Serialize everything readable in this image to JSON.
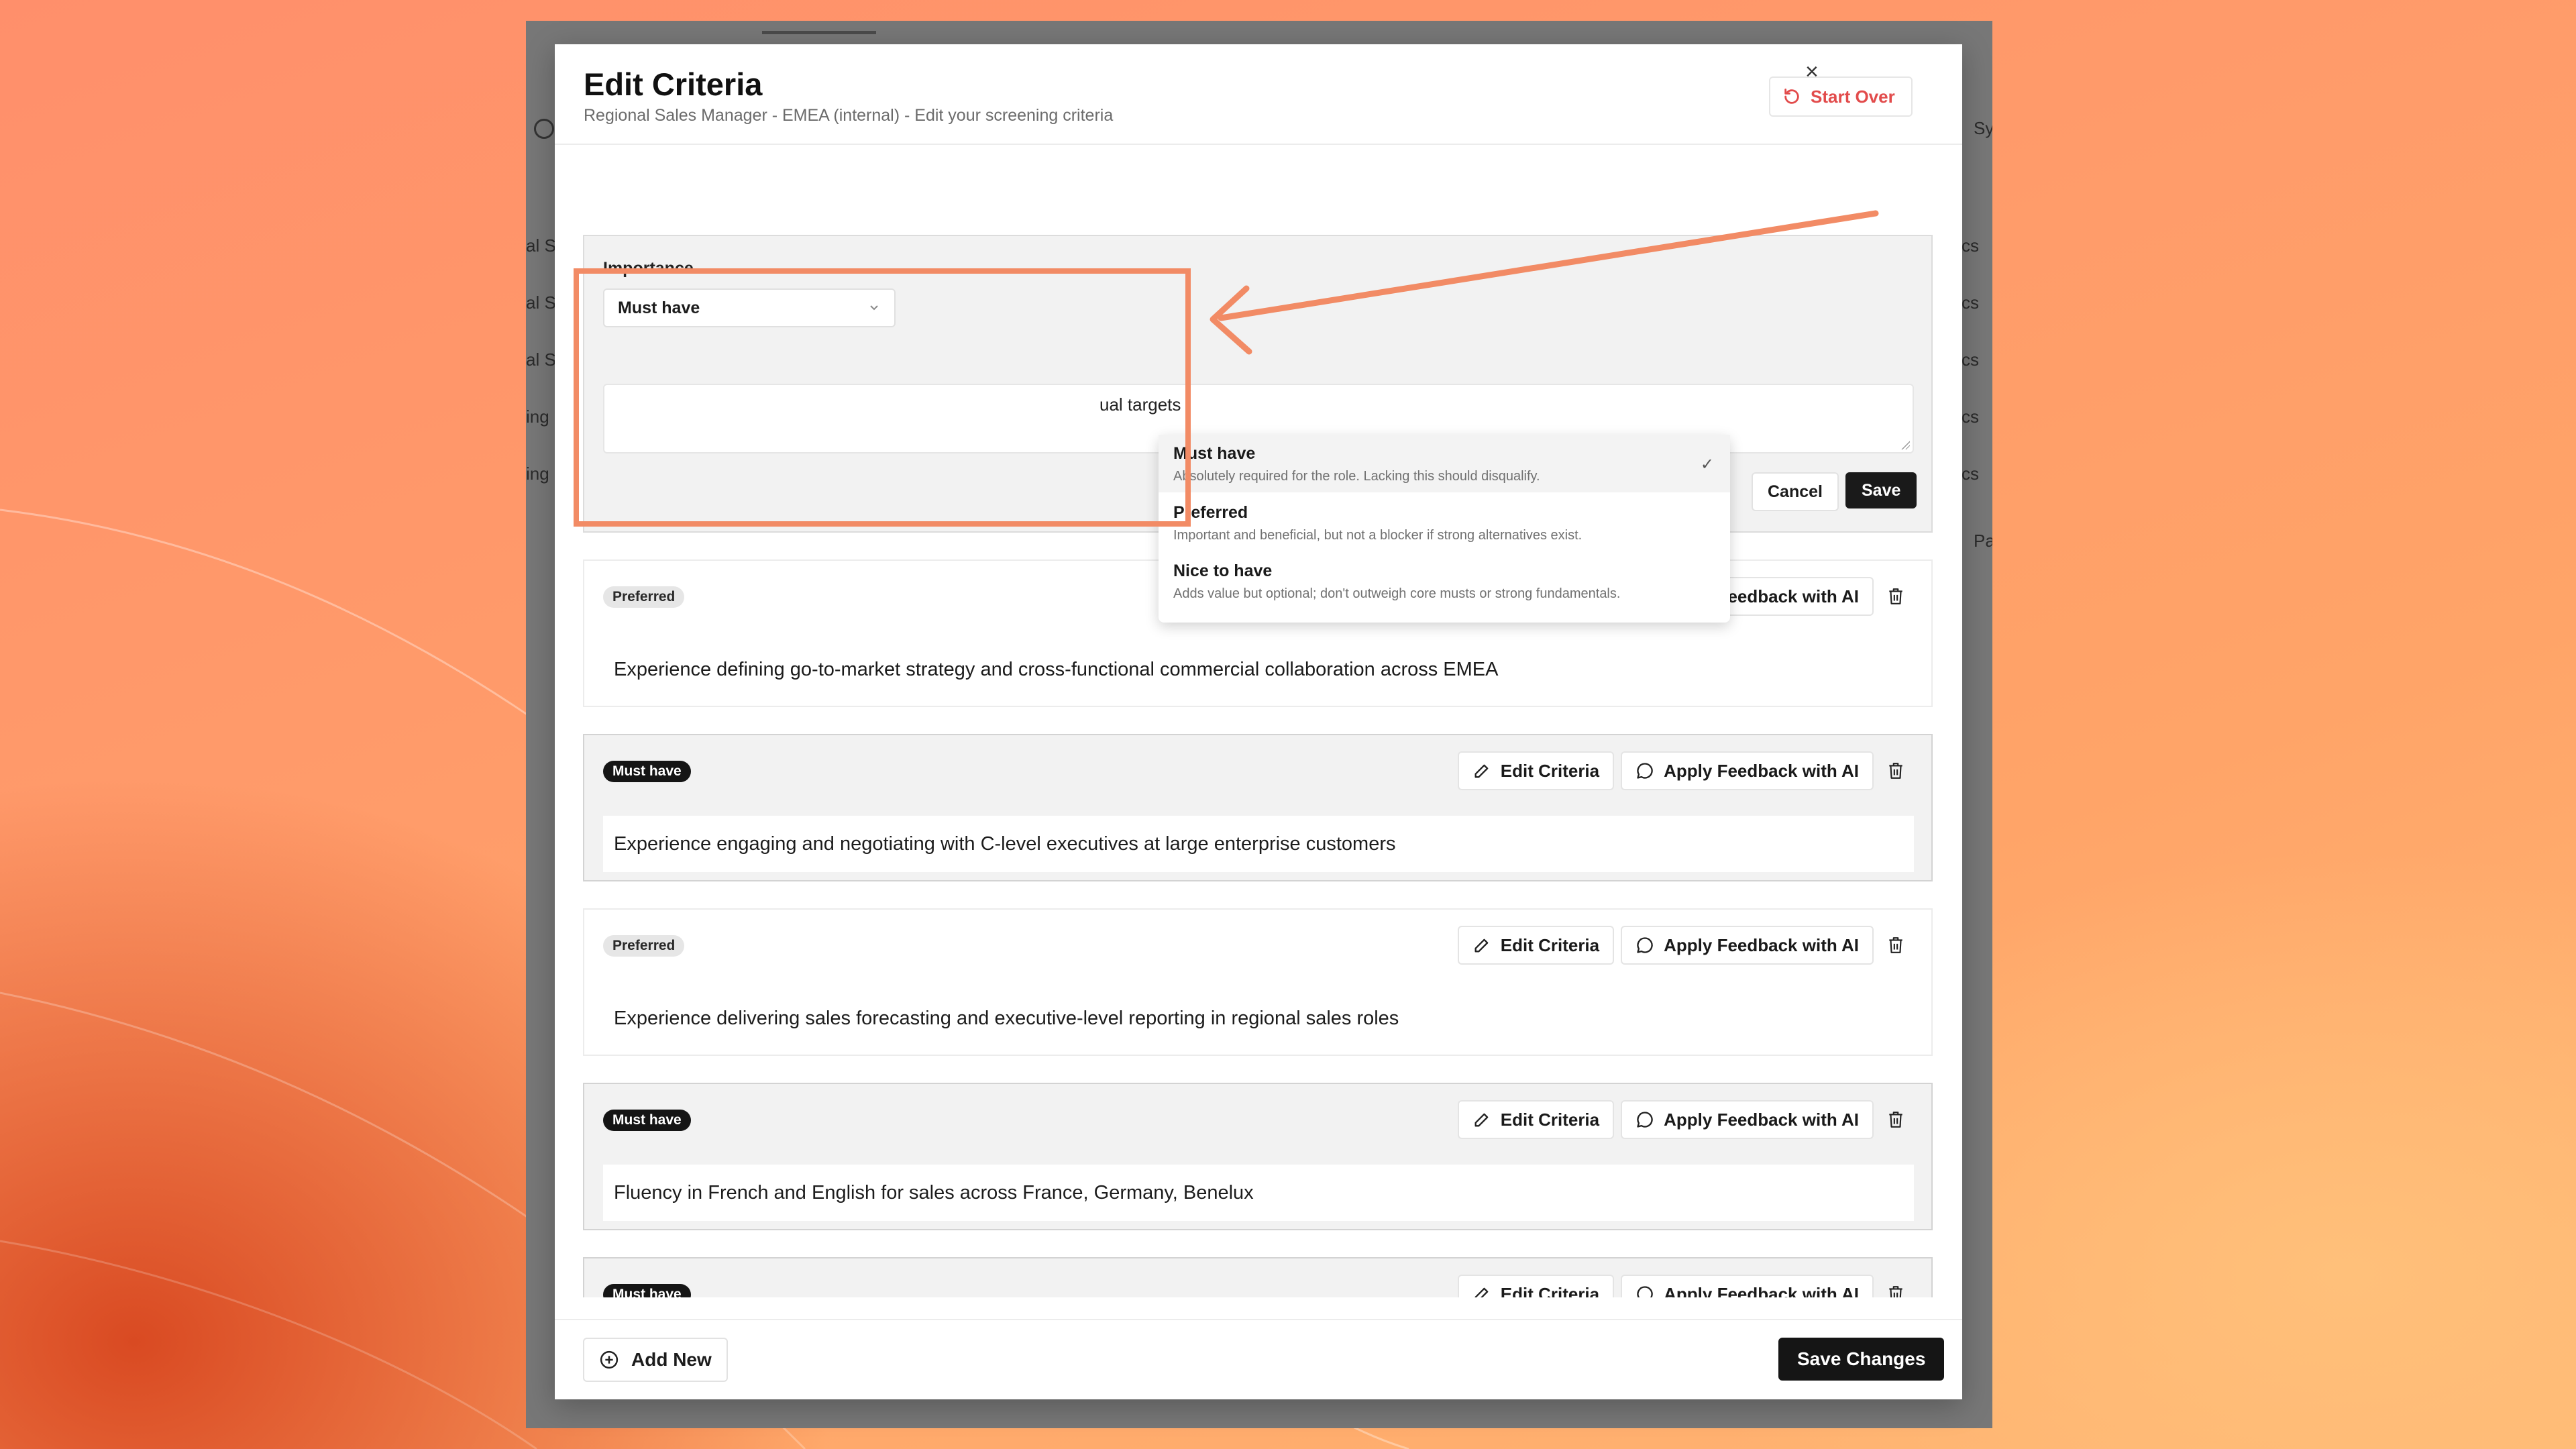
{
  "background_fragments": [
    "al S",
    "al S",
    "al S",
    "ing",
    "ing",
    "Sy",
    "cs",
    "cs",
    "cs",
    "cs",
    "cs",
    "Pa"
  ],
  "modal": {
    "title": "Edit Criteria",
    "subtitle": "Regional Sales Manager - EMEA (internal) - Edit your screening criteria",
    "start_over_label": "Start Over",
    "close_glyph": "×"
  },
  "editor": {
    "importance_label": "Importance",
    "selected_value": "Must have",
    "textarea_value": "ual targets",
    "cancel_label": "Cancel",
    "save_label": "Save"
  },
  "dropdown": {
    "options": [
      {
        "label": "Must have",
        "description": "Absolutely required for the role. Lacking this should disqualify.",
        "selected": true
      },
      {
        "label": "Preferred",
        "description": "Important and beneficial, but not a blocker if strong alternatives exist."
      },
      {
        "label": "Nice to have",
        "description": "Adds value but optional; don't outweigh core musts or strong fundamentals."
      }
    ]
  },
  "row_actions": {
    "edit_label": "Edit Criteria",
    "feedback_label": "Apply Feedback with AI"
  },
  "criteria": [
    {
      "importance": "Preferred",
      "text": "Experience defining go-to-market strategy and cross-functional commercial collaboration across EMEA"
    },
    {
      "importance": "Must have",
      "text": "Experience engaging and negotiating with C-level executives at large enterprise customers"
    },
    {
      "importance": "Preferred",
      "text": "Experience delivering sales forecasting and executive-level reporting in regional sales roles"
    },
    {
      "importance": "Must have",
      "text": "Fluency in French and English for sales across France, Germany, Benelux"
    },
    {
      "importance": "Must have",
      "text": ""
    }
  ],
  "footer": {
    "add_new_label": "Add New",
    "save_changes_label": "Save Changes"
  },
  "colors": {
    "accent_red": "#e24b4b",
    "highlight_orange": "#f28b65",
    "dark_button": "#151515"
  }
}
